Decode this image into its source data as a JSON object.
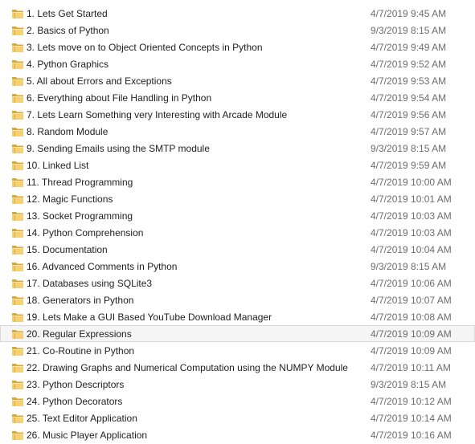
{
  "colors": {
    "folder_back": "#d9a83b",
    "folder_front": "#f5d172",
    "name_text": "#1e1e1e",
    "date_text": "#6d6d6d",
    "selected_bg": "#f5f5f5"
  },
  "files": [
    {
      "name": "1. Lets Get Started",
      "modified": "4/7/2019 9:45 AM",
      "icon": "folder-icon"
    },
    {
      "name": "2. Basics of Python",
      "modified": "9/3/2019 8:15 AM",
      "icon": "folder-icon"
    },
    {
      "name": "3. Lets move on to Object Oriented Concepts in Python",
      "modified": "4/7/2019 9:49 AM",
      "icon": "folder-icon"
    },
    {
      "name": "4. Python Graphics",
      "modified": "4/7/2019 9:52 AM",
      "icon": "folder-icon"
    },
    {
      "name": "5. All about Errors and Exceptions",
      "modified": "4/7/2019 9:53 AM",
      "icon": "folder-icon"
    },
    {
      "name": "6. Everything about File Handling in Python",
      "modified": "4/7/2019 9:54 AM",
      "icon": "folder-icon"
    },
    {
      "name": "7. Lets Learn Something very Interesting with Arcade Module",
      "modified": "4/7/2019 9:56 AM",
      "icon": "folder-icon"
    },
    {
      "name": "8. Random Module",
      "modified": "4/7/2019 9:57 AM",
      "icon": "folder-icon"
    },
    {
      "name": "9. Sending Emails using the SMTP module",
      "modified": "9/3/2019 8:15 AM",
      "icon": "folder-icon"
    },
    {
      "name": "10. Linked List",
      "modified": "4/7/2019 9:59 AM",
      "icon": "folder-icon"
    },
    {
      "name": "11. Thread Programming",
      "modified": "4/7/2019 10:00 AM",
      "icon": "folder-icon"
    },
    {
      "name": "12. Magic Functions",
      "modified": "4/7/2019 10:01 AM",
      "icon": "folder-icon"
    },
    {
      "name": "13. Socket Programming",
      "modified": "4/7/2019 10:03 AM",
      "icon": "folder-icon"
    },
    {
      "name": "14. Python Comprehension",
      "modified": "4/7/2019 10:03 AM",
      "icon": "folder-icon"
    },
    {
      "name": "15. Documentation",
      "modified": "4/7/2019 10:04 AM",
      "icon": "folder-icon"
    },
    {
      "name": "16. Advanced Comments in Python",
      "modified": "9/3/2019 8:15 AM",
      "icon": "folder-icon"
    },
    {
      "name": "17. Databases using SQLite3",
      "modified": "4/7/2019 10:06 AM",
      "icon": "folder-icon"
    },
    {
      "name": "18. Generators in Python",
      "modified": "4/7/2019 10:07 AM",
      "icon": "folder-icon"
    },
    {
      "name": "19. Lets Make a GUI Based YouTube Download Manager",
      "modified": "4/7/2019 10:08 AM",
      "icon": "folder-icon"
    },
    {
      "name": "20. Regular Expressions",
      "modified": "4/7/2019 10:09 AM",
      "icon": "folder-icon",
      "selected": true
    },
    {
      "name": "21. Co-Routine in Python",
      "modified": "4/7/2019 10:09 AM",
      "icon": "folder-icon"
    },
    {
      "name": "22. Drawing Graphs and Numerical Computation using the NUMPY Module",
      "modified": "4/7/2019 10:11 AM",
      "icon": "folder-icon"
    },
    {
      "name": "23. Python Descriptors",
      "modified": "9/3/2019 8:15 AM",
      "icon": "folder-icon"
    },
    {
      "name": "24. Python Decorators",
      "modified": "4/7/2019 10:12 AM",
      "icon": "folder-icon"
    },
    {
      "name": "25. Text Editor Application",
      "modified": "4/7/2019 10:14 AM",
      "icon": "folder-icon"
    },
    {
      "name": "26. Music Player Application",
      "modified": "4/7/2019 10:16 AM",
      "icon": "folder-icon"
    }
  ]
}
